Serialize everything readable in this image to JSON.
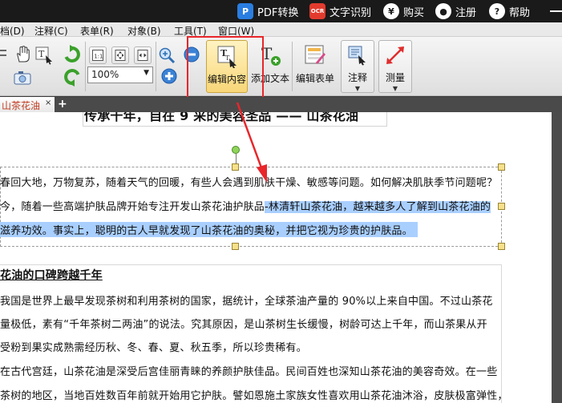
{
  "topbar": {
    "pdf_convert": "PDF转换",
    "ocr_badge": "OCR",
    "ocr": "文字识别",
    "buy": "购买",
    "register": "注册",
    "help": "帮助"
  },
  "menu": [
    "档(D)",
    "注释(C)",
    "表单(R)",
    "对象(B)",
    "工具(T)",
    "窗口(W)"
  ],
  "toolbar": {
    "zoom": "100%",
    "edit_content": "编辑内容",
    "add_text": "添加文本",
    "edit_form": "编辑表单",
    "annotate": "注释",
    "measure": "测量"
  },
  "tab": {
    "title": "山茶花油",
    "close": "×",
    "add": "+"
  },
  "doc": {
    "title_partial": "传承千年，自在 9 采的美容圣品 —— 山茶花油",
    "para1": [
      "春回大地，万物复苏，随着天气的回暖，有些人会遇到肌肤干燥、敏感等问题。如何解决肌肤季节问题呢？",
      "今，随着一些高端护肤品牌开始专注开发山茶花油护肤品",
      "-林清轩山茶花油，越来越多人了解到山茶花油的",
      "滋养功效。事实上，聪明的古人早就发现了山茶花油的奥秘，并把它视为珍贵的护肤品。"
    ],
    "section_title": "花油的口碑跨越千年",
    "para2": [
      "我国是世界上最早发现茶树和利用茶树的国家，据统计，全球茶油产量的 90%以上来自中国。不过山茶花",
      "量极低，素有“千年茶树二两油”的说法。究其原因，是山茶树生长缓慢，树龄可达上千年，而山茶果从开",
      "受粉到果实成熟需经历秋、冬、春、夏、秋五季，所以珍贵稀有。",
      "在古代宫廷，山茶花油是深受后宫佳丽青睐的养颜护肤佳品。民间百姓也深知山茶花油的美容奇效。在一些",
      "茶树的地区，当地百姓数百年前就开始用它护肤。譬如恩施土家族女性喜欢用山茶花油沐浴，皮肤极富弹性，"
    ]
  },
  "colors": {
    "highlight_box": "#e8262b",
    "selection": "#a9cfff",
    "tab_text": "#c03a1f"
  }
}
